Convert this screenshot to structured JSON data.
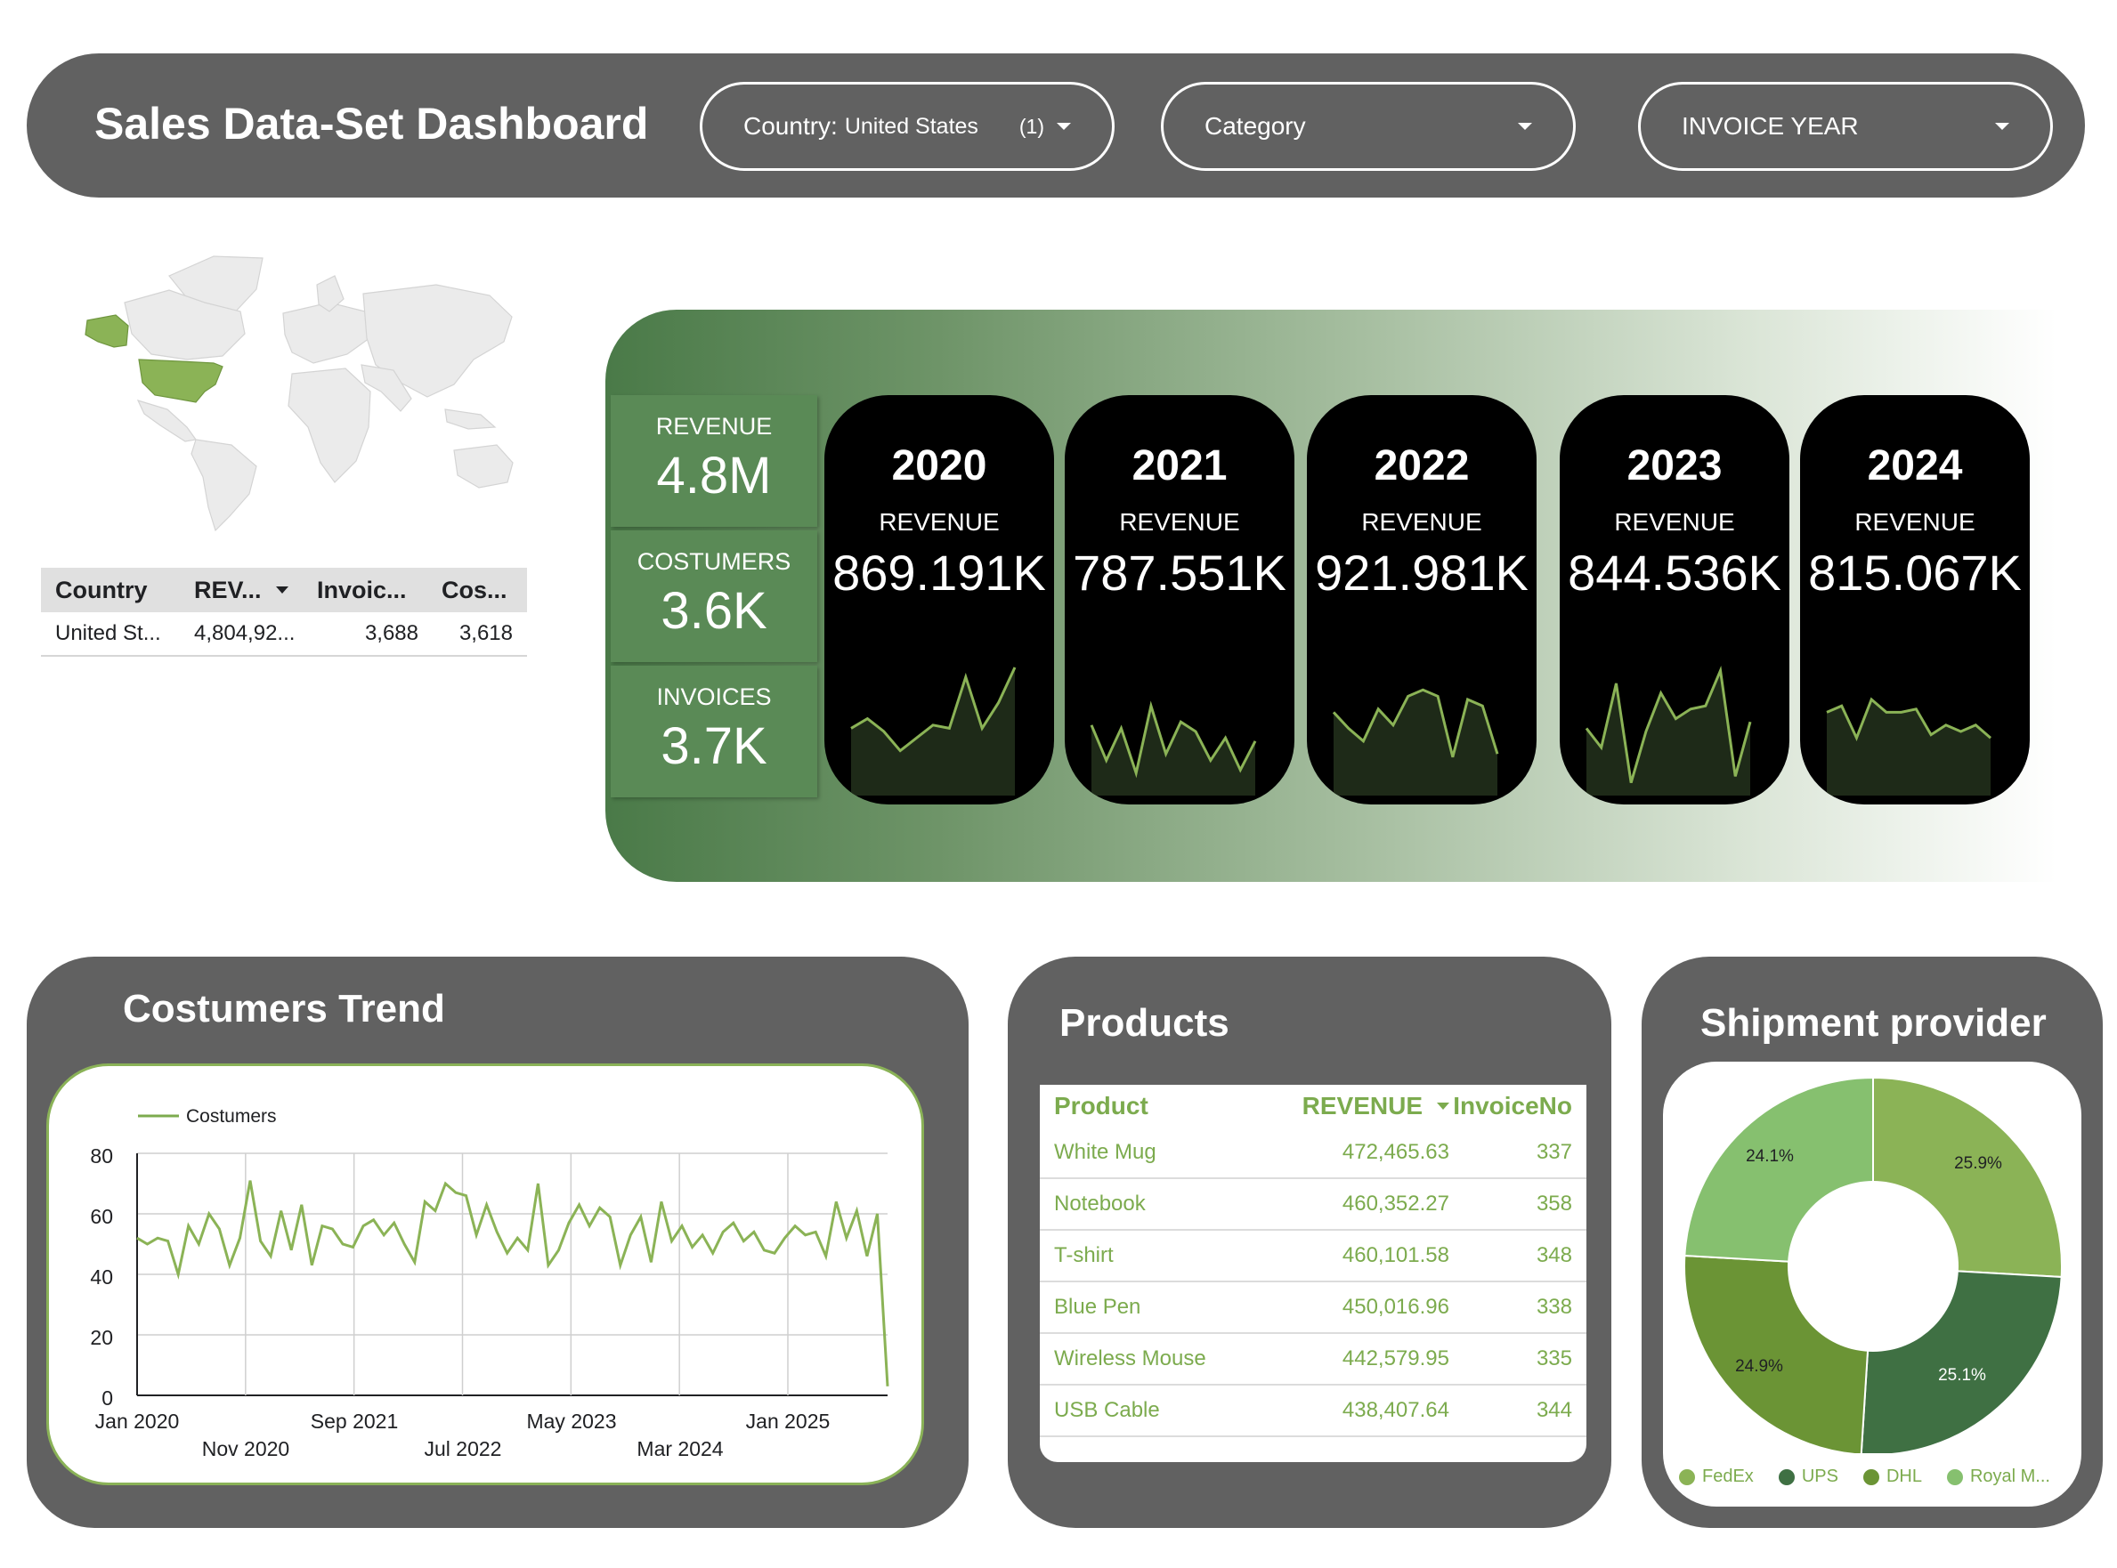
{
  "header": {
    "title": "Sales Data-Set Dashboard",
    "filters": [
      {
        "label": "Country:",
        "value": "United States",
        "count": "(1)"
      },
      {
        "label": "Category"
      },
      {
        "label": "INVOICE YEAR"
      }
    ]
  },
  "country_table": {
    "columns": [
      "Country",
      "REV...",
      "Invoic...",
      "Cos..."
    ],
    "rows": [
      [
        "United St...",
        "4,804,92...",
        "3,688",
        "3,618"
      ]
    ]
  },
  "kpis": [
    {
      "label": "REVENUE",
      "value": "4.8M"
    },
    {
      "label": "COSTUMERS",
      "value": "3.6K"
    },
    {
      "label": "INVOICES",
      "value": "3.7K"
    }
  ],
  "year_cards": [
    {
      "year": "2020",
      "label": "REVENUE",
      "value": "869.191K",
      "spark": [
        0.42,
        0.48,
        0.4,
        0.28,
        0.36,
        0.44,
        0.42,
        0.74,
        0.42,
        0.58,
        0.8
      ]
    },
    {
      "year": "2021",
      "label": "REVENUE",
      "value": "787.551K",
      "spark": [
        0.44,
        0.22,
        0.42,
        0.14,
        0.56,
        0.26,
        0.46,
        0.4,
        0.22,
        0.36,
        0.16,
        0.34
      ]
    },
    {
      "year": "2022",
      "label": "REVENUE",
      "value": "921.981K",
      "spark": [
        0.52,
        0.42,
        0.34,
        0.54,
        0.44,
        0.62,
        0.66,
        0.62,
        0.24,
        0.6,
        0.56,
        0.26
      ]
    },
    {
      "year": "2023",
      "label": "REVENUE",
      "value": "844.536K",
      "spark": [
        0.42,
        0.3,
        0.7,
        0.08,
        0.4,
        0.64,
        0.48,
        0.54,
        0.56,
        0.78,
        0.12,
        0.46
      ]
    },
    {
      "year": "2024",
      "label": "REVENUE",
      "value": "815.067K",
      "spark": [
        0.52,
        0.56,
        0.36,
        0.6,
        0.52,
        0.52,
        0.54,
        0.38,
        0.44,
        0.4,
        0.44,
        0.36
      ]
    }
  ],
  "trend": {
    "title": "Costumers Trend",
    "legend": "Costumers",
    "y_ticks": [
      "80",
      "60",
      "40",
      "20",
      "0"
    ],
    "x_ticks_top": [
      "Jan 2020",
      "Sep 2021",
      "May 2023",
      "Jan 2025"
    ],
    "x_ticks_bottom": [
      "Nov 2020",
      "Jul 2022",
      "Mar 2024"
    ]
  },
  "chart_data": [
    {
      "type": "line",
      "title": "Costumers Trend",
      "series": [
        {
          "name": "Costumers",
          "values": [
            52,
            50,
            52,
            51,
            40,
            56,
            50,
            60,
            55,
            43,
            52,
            71,
            51,
            46,
            61,
            48,
            63,
            43,
            56,
            55,
            50,
            49,
            56,
            58,
            53,
            57,
            50,
            44,
            64,
            61,
            70,
            67,
            66,
            53,
            63,
            54,
            47,
            52,
            48,
            70,
            43,
            48,
            57,
            63,
            56,
            62,
            59,
            43,
            53,
            59,
            44,
            64,
            51,
            56,
            49,
            53,
            47,
            54,
            57,
            51,
            54,
            48,
            47,
            52,
            56,
            53,
            54,
            46,
            64,
            52,
            61,
            46,
            60,
            3
          ]
        }
      ],
      "x_start": "Jan 2020",
      "x_end": "Mar 2025",
      "ylim": [
        0,
        80
      ],
      "grid": true,
      "legend_position": "top-left"
    },
    {
      "type": "pie",
      "title": "Shipment provider",
      "labels": [
        "FedEx",
        "UPS",
        "DHL",
        "Royal M..."
      ],
      "values": [
        25.9,
        25.1,
        24.9,
        24.1
      ],
      "colors": [
        "#8bb356",
        "#3f7043",
        "#6b9435",
        "#86c06f"
      ]
    }
  ],
  "products": {
    "title": "Products",
    "columns": [
      "Product",
      "REVENUE",
      "InvoiceNo"
    ],
    "rows": [
      [
        "White Mug",
        "472,465.63",
        "337"
      ],
      [
        "Notebook",
        "460,352.27",
        "358"
      ],
      [
        "T-shirt",
        "460,101.58",
        "348"
      ],
      [
        "Blue Pen",
        "450,016.96",
        "338"
      ],
      [
        "Wireless Mouse",
        "442,579.95",
        "335"
      ],
      [
        "USB Cable",
        "438,407.64",
        "344"
      ]
    ]
  },
  "shipment": {
    "title": "Shipment provider",
    "slice_labels": [
      "25.9%",
      "25.1%",
      "24.9%",
      "24.1%"
    ],
    "legend": [
      "FedEx",
      "UPS",
      "DHL",
      "Royal M..."
    ]
  },
  "colors": {
    "header_bg": "#616161",
    "accent_green": "#7cab4e",
    "kpi_green": "#5a8a56",
    "card_bg": "#000000"
  }
}
